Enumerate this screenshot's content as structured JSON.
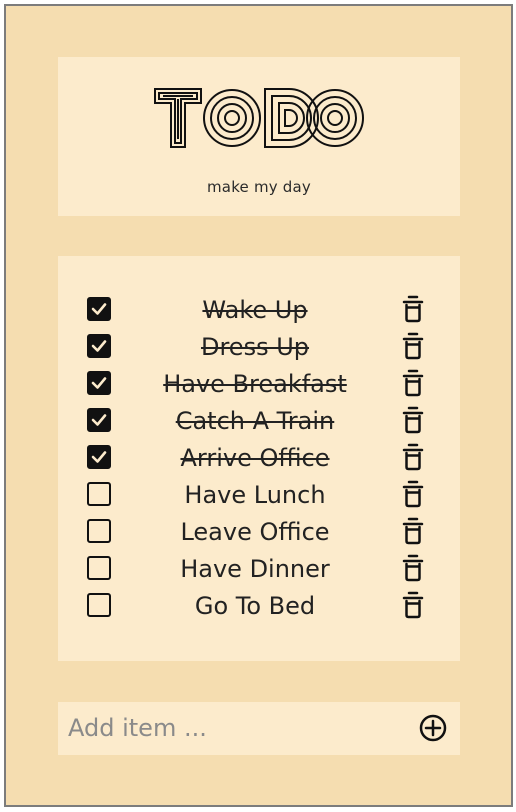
{
  "header": {
    "logo_text": "TODO",
    "subtitle": "make my day"
  },
  "todos": [
    {
      "label": "Wake Up",
      "done": true
    },
    {
      "label": "Dress Up",
      "done": true
    },
    {
      "label": "Have Breakfast",
      "done": true
    },
    {
      "label": "Catch A Train",
      "done": true
    },
    {
      "label": "Arrive Office",
      "done": true
    },
    {
      "label": "Have Lunch",
      "done": false
    },
    {
      "label": "Leave Office",
      "done": false
    },
    {
      "label": "Have Dinner",
      "done": false
    },
    {
      "label": "Go To Bed",
      "done": false
    }
  ],
  "add_item": {
    "placeholder": "Add item ...",
    "value": ""
  },
  "icons": {
    "checkbox": "checkbox-icon",
    "delete": "trash-icon",
    "add": "plus-circle-icon"
  },
  "colors": {
    "background": "#f5ddb0",
    "card": "#fcebcc",
    "ink": "#111111"
  }
}
